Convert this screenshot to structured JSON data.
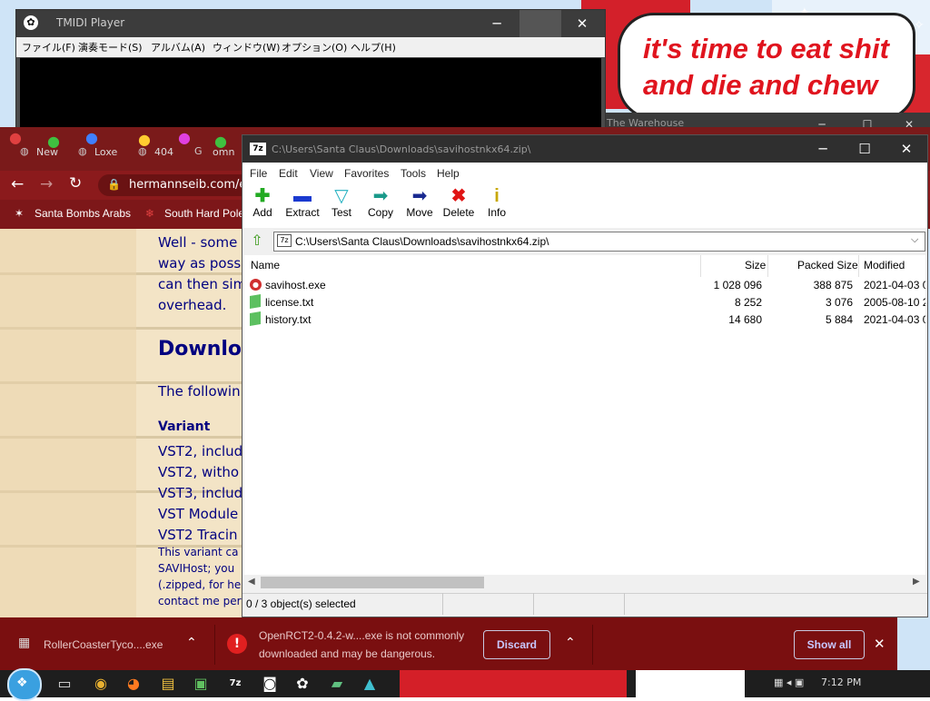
{
  "bubble": {
    "text": "it's time to eat shit and die and chew"
  },
  "tmidi": {
    "title": "TMIDI Player",
    "menu": [
      "ファイル(F)",
      "演奏モード(S)",
      "アルバム(A)",
      "ウィンドウ(W)",
      "オプション(O)",
      "ヘルプ(H)"
    ]
  },
  "behind_window": {
    "title": "The Warehouse"
  },
  "browser": {
    "tabs": [
      "New",
      "Loxe",
      "404",
      "omn"
    ],
    "url": "hermannseib.com/e",
    "bookmarks": [
      "Santa Bombs Arabs",
      "South Hard Pole"
    ],
    "content": {
      "p1": "Well - some",
      "p2": "way as possi",
      "p3": "can then sim",
      "p4": "overhead.",
      "heading": "Download",
      "intro": "The followin",
      "variant_head": "Variant",
      "v1": "VST2, includ",
      "v2": "VST2, witho",
      "v3": "VST3, includ",
      "v4": "VST Module",
      "v5": "VST2 Tracin",
      "s1": "This variant ca",
      "s2": "SAVIHost; you",
      "s3": "(.zipped, for he",
      "s4": "contact me per"
    }
  },
  "zip": {
    "title": "C:\\Users\\Santa Claus\\Downloads\\savihostnkx64.zip\\",
    "menu": [
      "File",
      "Edit",
      "View",
      "Favorites",
      "Tools",
      "Help"
    ],
    "toolbar": [
      {
        "label": "Add",
        "icon": "plus-icon",
        "color": "#22aa22"
      },
      {
        "label": "Extract",
        "icon": "minus-icon",
        "color": "#1a3ad0"
      },
      {
        "label": "Test",
        "icon": "check-icon",
        "color": "#22b0c0"
      },
      {
        "label": "Copy",
        "icon": "copy-arrow-icon",
        "color": "#1a9a8a"
      },
      {
        "label": "Move",
        "icon": "move-arrow-icon",
        "color": "#1a2a90"
      },
      {
        "label": "Delete",
        "icon": "x-icon",
        "color": "#e01515"
      },
      {
        "label": "Info",
        "icon": "info-icon",
        "color": "#c8a800"
      }
    ],
    "path": "C:\\Users\\Santa Claus\\Downloads\\savihostnkx64.zip\\",
    "columns": [
      "Name",
      "Size",
      "Packed Size",
      "Modified"
    ],
    "files": [
      {
        "name": "savihost.exe",
        "size": "1 028 096",
        "packed": "388 875",
        "modified": "2021-04-03 0",
        "icon": "exe-icon"
      },
      {
        "name": "license.txt",
        "size": "8 252",
        "packed": "3 076",
        "modified": "2005-08-10 2",
        "icon": "txt-icon"
      },
      {
        "name": "history.txt",
        "size": "14 680",
        "packed": "5 884",
        "modified": "2021-04-03 0",
        "icon": "txt-icon"
      }
    ],
    "status": "0 / 3 object(s) selected"
  },
  "downloads": {
    "item1": "RollerCoasterTyco....exe",
    "warning_line1": "OpenRCT2-0.4.2-w....exe is not commonly",
    "warning_line2": "downloaded and may be dangerous.",
    "discard": "Discard",
    "show_all": "Show all"
  },
  "taskbar": {
    "clock": "7:12 PM"
  }
}
